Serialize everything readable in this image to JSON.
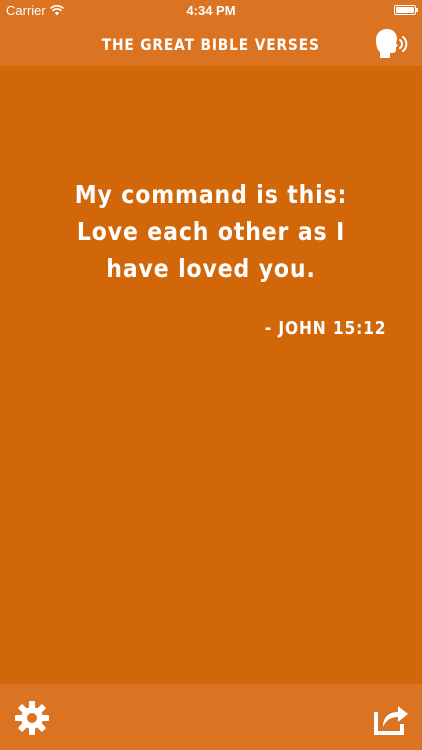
{
  "status_bar": {
    "carrier": "Carrier",
    "time": "4:34 PM"
  },
  "nav": {
    "title": "THE GREAT BIBLE VERSES",
    "speak_icon": "speaking-head-icon"
  },
  "verse": {
    "lines": [
      "My command is this:",
      "Love each other as I",
      "have loved you."
    ],
    "reference": "- JOHN 15:12"
  },
  "bottom_bar": {
    "settings_icon": "gear-icon",
    "share_icon": "share-icon"
  },
  "colors": {
    "background": "#D2670A",
    "bars": "#DA7322",
    "text": "#FFFFFF"
  }
}
